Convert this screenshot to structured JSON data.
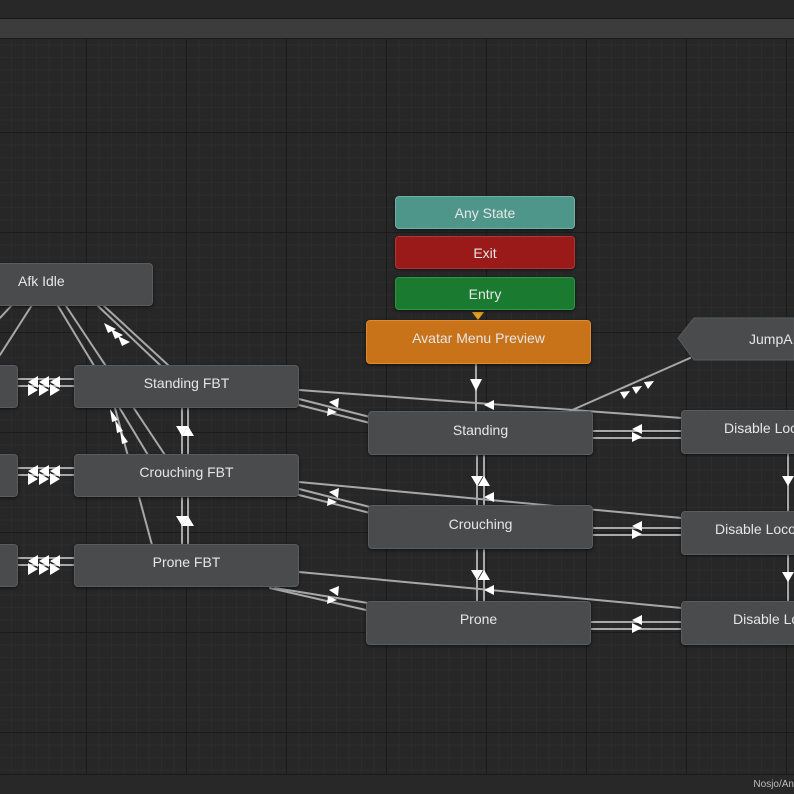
{
  "window": {
    "status_path": "Nosjo/An"
  },
  "states": {
    "any_state": "Any State",
    "exit": "Exit",
    "entry": "Entry",
    "avatar_menu_preview": "Avatar Menu Preview",
    "jump": "JumpA",
    "afk_idle": "Afk Idle",
    "standing_fbt": "Standing FBT",
    "crouching_fbt": "Crouching FBT",
    "prone_fbt": "Prone FBT",
    "standing": "Standing",
    "crouching": "Crouching",
    "prone": "Prone",
    "disable_loco_1": "Disable Loc",
    "disable_loco_2": "Disable Loco",
    "disable_loco_3": "Disable Lo"
  },
  "colors": {
    "background": "#272727",
    "state_node": "#4a4b4d",
    "any_state": "#4f968a",
    "exit": "#9a1a1a",
    "entry": "#1a7a30",
    "default_state": "#c8721a",
    "transition": "#b4b4b4"
  }
}
